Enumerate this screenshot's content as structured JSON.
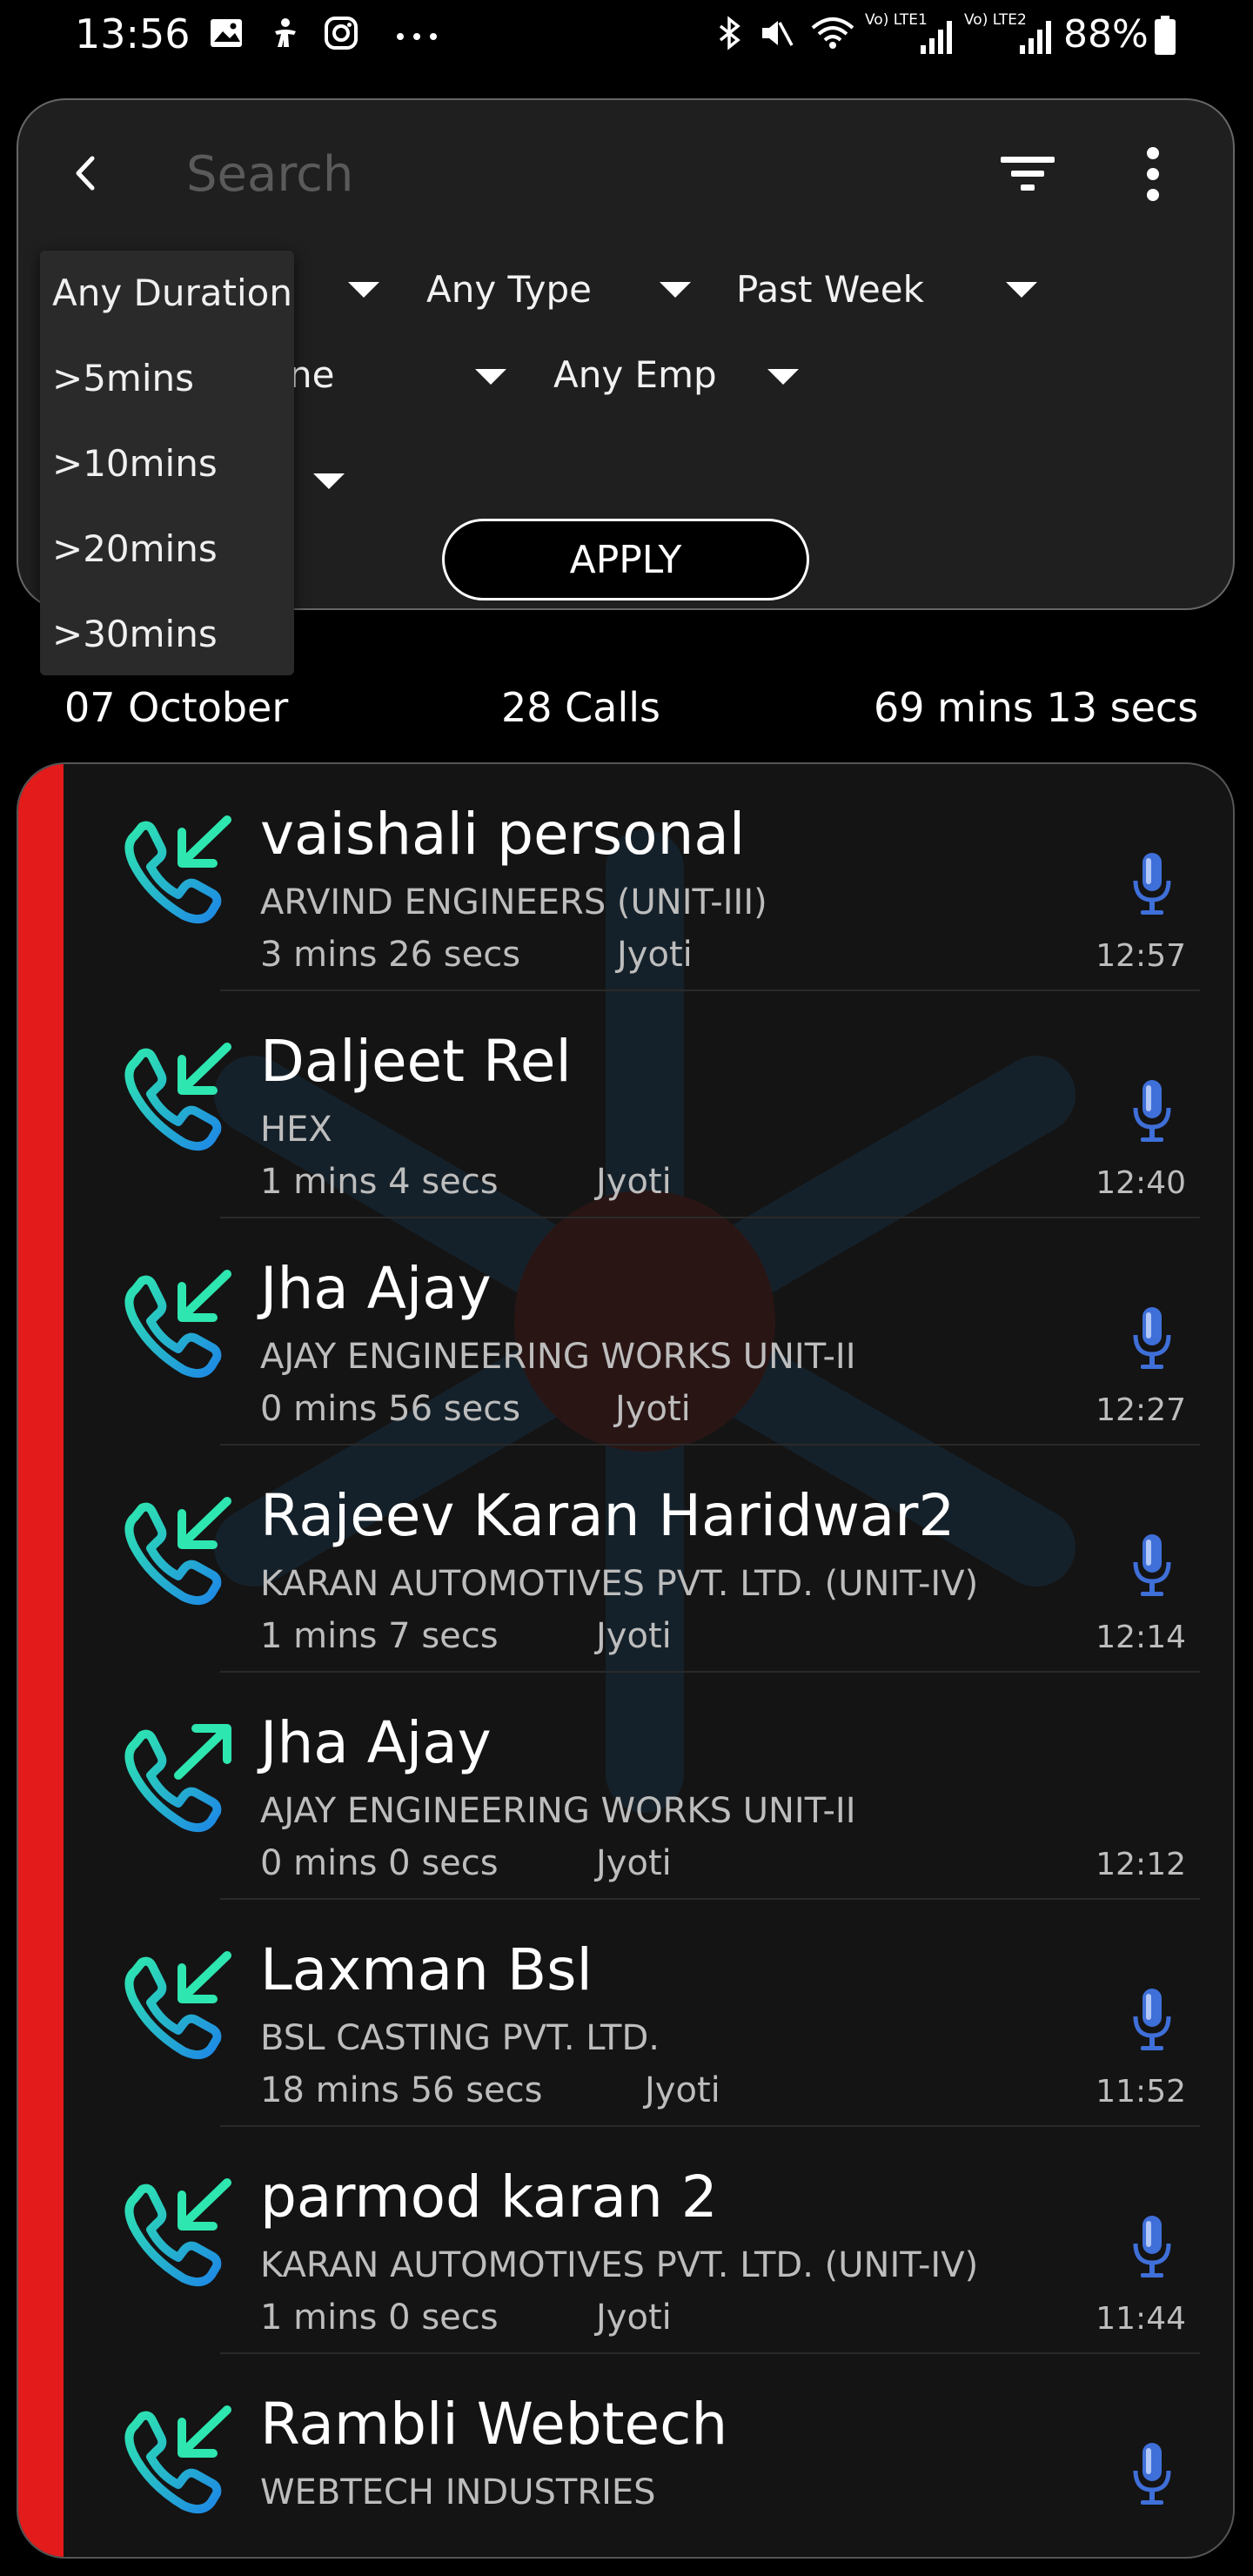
{
  "status_bar": {
    "time": "13:56",
    "battery": "88%",
    "icons": [
      "gallery-icon",
      "accessibility-icon",
      "instagram-icon",
      "more-dots-icon",
      "bluetooth-icon",
      "mute-icon",
      "wifi-icon",
      "lte1-signal-icon",
      "lte2-signal-icon",
      "battery-icon"
    ],
    "lte1": "Vo) LTE1",
    "lte2": "Vo) LTE2"
  },
  "search": {
    "placeholder": "Search"
  },
  "filters": {
    "duration": "Any Duration",
    "type": "Any Type",
    "period": "Past Week",
    "name": "ne",
    "emp": "Any Emp",
    "apply_label": "APPLY"
  },
  "duration_dropdown": {
    "options": [
      "Any Duration",
      ">5mins",
      ">10mins",
      ">20mins",
      ">30mins"
    ]
  },
  "summary": {
    "date": "07 October",
    "calls": "28 Calls",
    "total_duration": "69 mins 13 secs"
  },
  "calls": [
    {
      "name": "vaishali personal",
      "company": "ARVIND ENGINEERS (UNIT-III)",
      "duration": "3 mins 26 secs",
      "employee": "Jyoti",
      "time": "12:57",
      "direction": "incoming",
      "recording": true
    },
    {
      "name": "Daljeet Rel",
      "company": "HEX",
      "duration": "1 mins 4 secs",
      "employee": "Jyoti",
      "time": "12:40",
      "direction": "incoming",
      "recording": true
    },
    {
      "name": "Jha Ajay",
      "company": "AJAY ENGINEERING WORKS UNIT-II",
      "duration": "0 mins 56 secs",
      "employee": "Jyoti",
      "time": "12:27",
      "direction": "incoming",
      "recording": true
    },
    {
      "name": "Rajeev Karan Haridwar2",
      "company": "KARAN AUTOMOTIVES PVT. LTD. (UNIT-IV)",
      "duration": "1 mins 7 secs",
      "employee": "Jyoti",
      "time": "12:14",
      "direction": "incoming",
      "recording": true
    },
    {
      "name": "Jha Ajay",
      "company": "AJAY ENGINEERING WORKS UNIT-II",
      "duration": "0 mins 0 secs",
      "employee": "Jyoti",
      "time": "12:12",
      "direction": "outgoing",
      "recording": false
    },
    {
      "name": "Laxman Bsl",
      "company": "BSL CASTING PVT. LTD.",
      "duration": "18 mins 56 secs",
      "employee": "Jyoti",
      "time": "11:52",
      "direction": "incoming",
      "recording": true
    },
    {
      "name": "parmod karan 2",
      "company": "KARAN AUTOMOTIVES PVT. LTD. (UNIT-IV)",
      "duration": "1 mins 0 secs",
      "employee": "Jyoti",
      "time": "11:44",
      "direction": "incoming",
      "recording": true
    },
    {
      "name": "Rambli Webtech",
      "company": "WEBTECH INDUSTRIES",
      "duration": "",
      "employee": "",
      "time": "",
      "direction": "incoming",
      "recording": true
    }
  ],
  "colors": {
    "accent_red": "#e31b1b",
    "call_icon_top": "#2ee6b0",
    "call_icon_bottom": "#1e88e5",
    "mic_blue": "#3f6fd8"
  }
}
